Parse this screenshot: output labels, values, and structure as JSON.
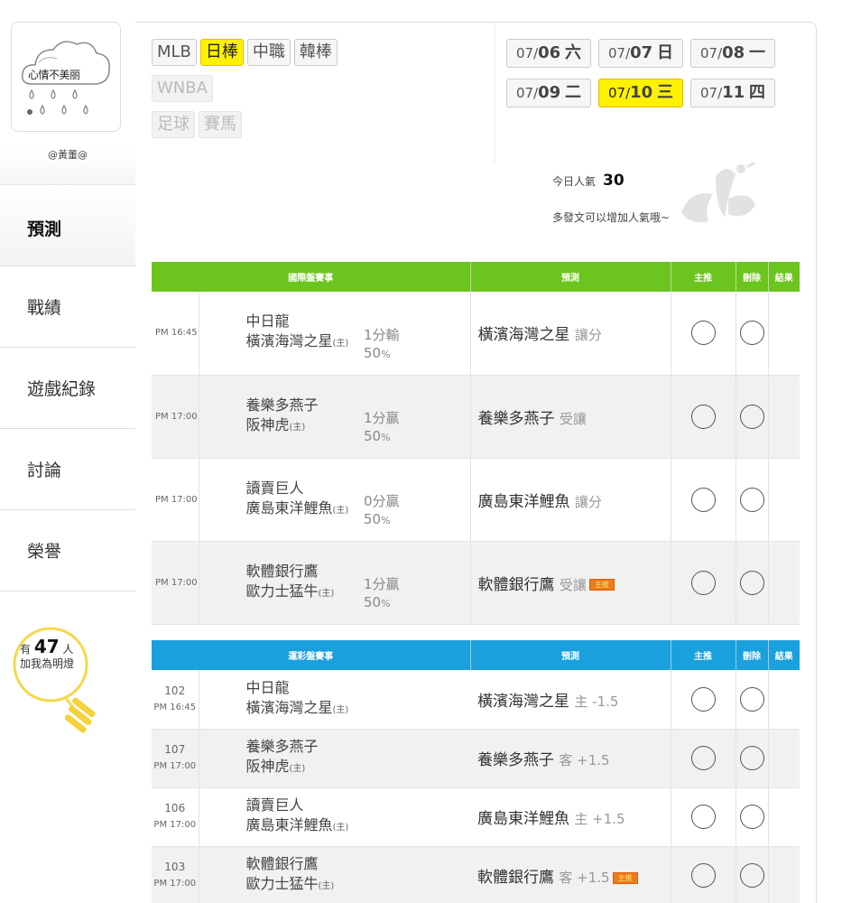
{
  "user": {
    "avatar_caption": "心情不美丽",
    "name": "@黃董@"
  },
  "nav": [
    {
      "label": "預測",
      "active": true
    },
    {
      "label": "戰績",
      "active": false
    },
    {
      "label": "遊戲紀錄",
      "active": false
    },
    {
      "label": "討論",
      "active": false
    },
    {
      "label": "榮譽",
      "active": false
    }
  ],
  "fans": {
    "prefix": "有",
    "count": "47",
    "suffix": "人",
    "caption": "加我為明燈"
  },
  "sports": [
    {
      "label": "MLB",
      "state": "normal"
    },
    {
      "label": "日棒",
      "state": "active"
    },
    {
      "label": "中職",
      "state": "normal"
    },
    {
      "label": "韓棒",
      "state": "normal"
    },
    {
      "label": "WNBA",
      "state": "disabled"
    },
    {
      "label": "足球",
      "state": "disabled"
    },
    {
      "label": "賽馬",
      "state": "disabled"
    }
  ],
  "dates": [
    {
      "month": "07/",
      "day": "06",
      "weekday": "六",
      "active": false
    },
    {
      "month": "07/",
      "day": "07",
      "weekday": "日",
      "active": false
    },
    {
      "month": "07/",
      "day": "08",
      "weekday": "一",
      "active": false
    },
    {
      "month": "07/",
      "day": "09",
      "weekday": "二",
      "active": false
    },
    {
      "month": "07/",
      "day": "10",
      "weekday": "三",
      "active": true
    },
    {
      "month": "07/",
      "day": "11",
      "weekday": "四",
      "active": false
    }
  ],
  "popularity": {
    "label": "今日人氣",
    "value": "30",
    "tip": "多發文可以增加人氣哦~"
  },
  "intl_table": {
    "headers": [
      "國際盤賽事",
      "預測",
      "主推",
      "刪除",
      "結果"
    ],
    "rows": [
      {
        "time": "PM 16:45",
        "away": "中日龍",
        "home": "橫濱海灣之星",
        "home_mark": "(主)",
        "result": "1分輸",
        "pct": "50",
        "pct_unit": "%",
        "pick": "橫濱海灣之星",
        "note": "讓分",
        "featured": false
      },
      {
        "time": "PM 17:00",
        "away": "養樂多燕子",
        "home": "阪神虎",
        "home_mark": "(主)",
        "result": "1分贏",
        "pct": "50",
        "pct_unit": "%",
        "pick": "養樂多燕子",
        "note": "受讓",
        "featured": false
      },
      {
        "time": "PM 17:00",
        "away": "讀賣巨人",
        "home": "廣島東洋鯉魚",
        "home_mark": "(主)",
        "result": "0分贏",
        "pct": "50",
        "pct_unit": "%",
        "pick": "廣島東洋鯉魚",
        "note": "讓分",
        "featured": false
      },
      {
        "time": "PM 17:00",
        "away": "軟體銀行鷹",
        "home": "歐力士猛牛",
        "home_mark": "(主)",
        "result": "1分贏",
        "pct": "50",
        "pct_unit": "%",
        "pick": "軟體銀行鷹",
        "note": "受讓",
        "featured": true,
        "badge": "主推"
      }
    ]
  },
  "lottery_table": {
    "headers": [
      "運彩盤賽事",
      "預測",
      "主推",
      "刪除",
      "結果"
    ],
    "rows": [
      {
        "num": "102",
        "time": "PM 16:45",
        "away": "中日龍",
        "home": "橫濱海灣之星",
        "home_mark": "(主)",
        "pick": "橫濱海灣之星",
        "note": "主 -1.5",
        "featured": false
      },
      {
        "num": "107",
        "time": "PM 17:00",
        "away": "養樂多燕子",
        "home": "阪神虎",
        "home_mark": "(主)",
        "pick": "養樂多燕子",
        "note": "客 +1.5",
        "featured": false
      },
      {
        "num": "106",
        "time": "PM 17:00",
        "away": "讀賣巨人",
        "home": "廣島東洋鯉魚",
        "home_mark": "(主)",
        "pick": "廣島東洋鯉魚",
        "note": "主 +1.5",
        "featured": false
      },
      {
        "num": "103",
        "time": "PM 17:00",
        "away": "軟體銀行鷹",
        "home": "歐力士猛牛",
        "home_mark": "(主)",
        "pick": "軟體銀行鷹",
        "note": "客 +1.5",
        "featured": true,
        "badge": "主推"
      }
    ]
  },
  "colors": {
    "intl_header": "#6cc41f",
    "lottery_header": "#1aa0dc",
    "active_yellow": "#fff100",
    "badge_orange": "#f07b1a"
  }
}
